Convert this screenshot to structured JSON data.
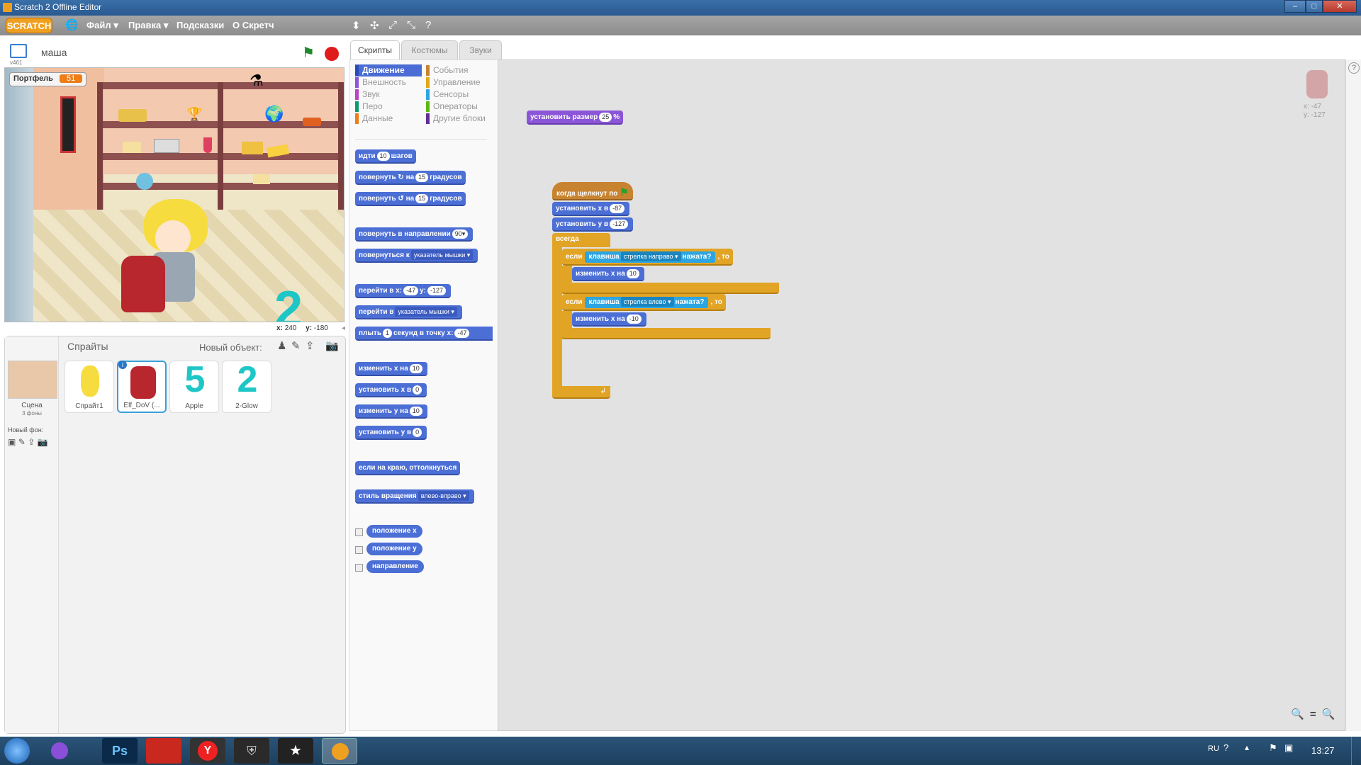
{
  "window": {
    "title": "Scratch 2 Offline Editor"
  },
  "menubar": {
    "logo": "SCRATCH",
    "items": [
      {
        "label": "Файл ▾"
      },
      {
        "label": "Правка ▾"
      },
      {
        "label": "Подсказки"
      },
      {
        "label": "О Скретч"
      }
    ]
  },
  "stage": {
    "project_name": "маша",
    "version": "v461",
    "variable": {
      "name": "Портфель",
      "value": "51"
    },
    "coords": {
      "x_label": "x:",
      "x": "240",
      "y_label": "y:",
      "y": "-180"
    }
  },
  "sprites_pane": {
    "title": "Спрайты",
    "new_object": "Новый объект:",
    "stage_label": "Сцена",
    "backdrops": "3 фоны",
    "new_backdrop": "Новый фон:",
    "sprites": [
      {
        "name": "Спрайт1"
      },
      {
        "name": "Elf_DoV (..."
      },
      {
        "name": "Apple",
        "glyph": "5"
      },
      {
        "name": "2-Glow",
        "glyph": "2"
      }
    ]
  },
  "tabs": [
    {
      "label": "Скрипты"
    },
    {
      "label": "Костюмы"
    },
    {
      "label": "Звуки"
    }
  ],
  "categories": {
    "left": [
      {
        "label": "Движение",
        "color": "#4a6cd4"
      },
      {
        "label": "Внешность",
        "color": "#8a55d7"
      },
      {
        "label": "Звук",
        "color": "#bb42c3"
      },
      {
        "label": "Перо",
        "color": "#0e9a6c"
      },
      {
        "label": "Данные",
        "color": "#ee7d16"
      }
    ],
    "right": [
      {
        "label": "События",
        "color": "#c88330"
      },
      {
        "label": "Управление",
        "color": "#e1a91a"
      },
      {
        "label": "Сенсоры",
        "color": "#2ca5e2"
      },
      {
        "label": "Операторы",
        "color": "#5cb712"
      },
      {
        "label": "Другие блоки",
        "color": "#632d99"
      }
    ]
  },
  "palette": {
    "move": {
      "a": "идти",
      "n": "10",
      "b": "шагов"
    },
    "turn_right": {
      "a": "повернуть",
      "icon": "↻",
      "b": "на",
      "n": "15",
      "c": "градусов"
    },
    "turn_left": {
      "a": "повернуть",
      "icon": "↺",
      "b": "на",
      "n": "15",
      "c": "градусов"
    },
    "point_dir": {
      "a": "повернуть в направлении",
      "n": "90▾"
    },
    "point_towards": {
      "a": "повернуться к",
      "d": "указатель мышки ▾"
    },
    "goto_xy": {
      "a": "перейти в x:",
      "x": "-47",
      "b": "y:",
      "y": "-127"
    },
    "goto": {
      "a": "перейти в",
      "d": "указатель мышки ▾"
    },
    "glide": {
      "a": "плыть",
      "n": "1",
      "b": "секунд в точку x:",
      "x": "-47"
    },
    "change_x": {
      "a": "изменить x на",
      "n": "10"
    },
    "set_x": {
      "a": "установить x в",
      "n": "0"
    },
    "change_y": {
      "a": "изменить y на",
      "n": "10"
    },
    "set_y": {
      "a": "установить y в",
      "n": "0"
    },
    "bounce": {
      "a": "если на краю, оттолкнуться"
    },
    "rotation": {
      "a": "стиль вращения",
      "d": "влево-вправо ▾"
    },
    "rep_x": "положение x",
    "rep_y": "положение y",
    "rep_dir": "направление"
  },
  "scripts": {
    "set_size": {
      "a": "установить размер",
      "n": "25",
      "b": "%"
    },
    "hat": {
      "a": "когда щелкнут по"
    },
    "set_x": {
      "a": "установить x в",
      "n": "-87"
    },
    "set_y": {
      "a": "установить y в",
      "n": "-127"
    },
    "forever": "всегда",
    "if1": {
      "a": "если",
      "s": "клавиша",
      "d": "стрелка направо ▾",
      "q": "нажата?",
      "b": ", то"
    },
    "change1": {
      "a": "изменить x на",
      "n": "10"
    },
    "if2": {
      "a": "если",
      "s": "клавиша",
      "d": "стрелка влево ▾",
      "q": "нажата?",
      "b": ", то"
    },
    "change2": {
      "a": "изменить x на",
      "n": "-10"
    }
  },
  "sprite_info": {
    "x": "x: -47",
    "y": "y: -127"
  },
  "taskbar": {
    "lang": "RU",
    "time": "13:27"
  }
}
